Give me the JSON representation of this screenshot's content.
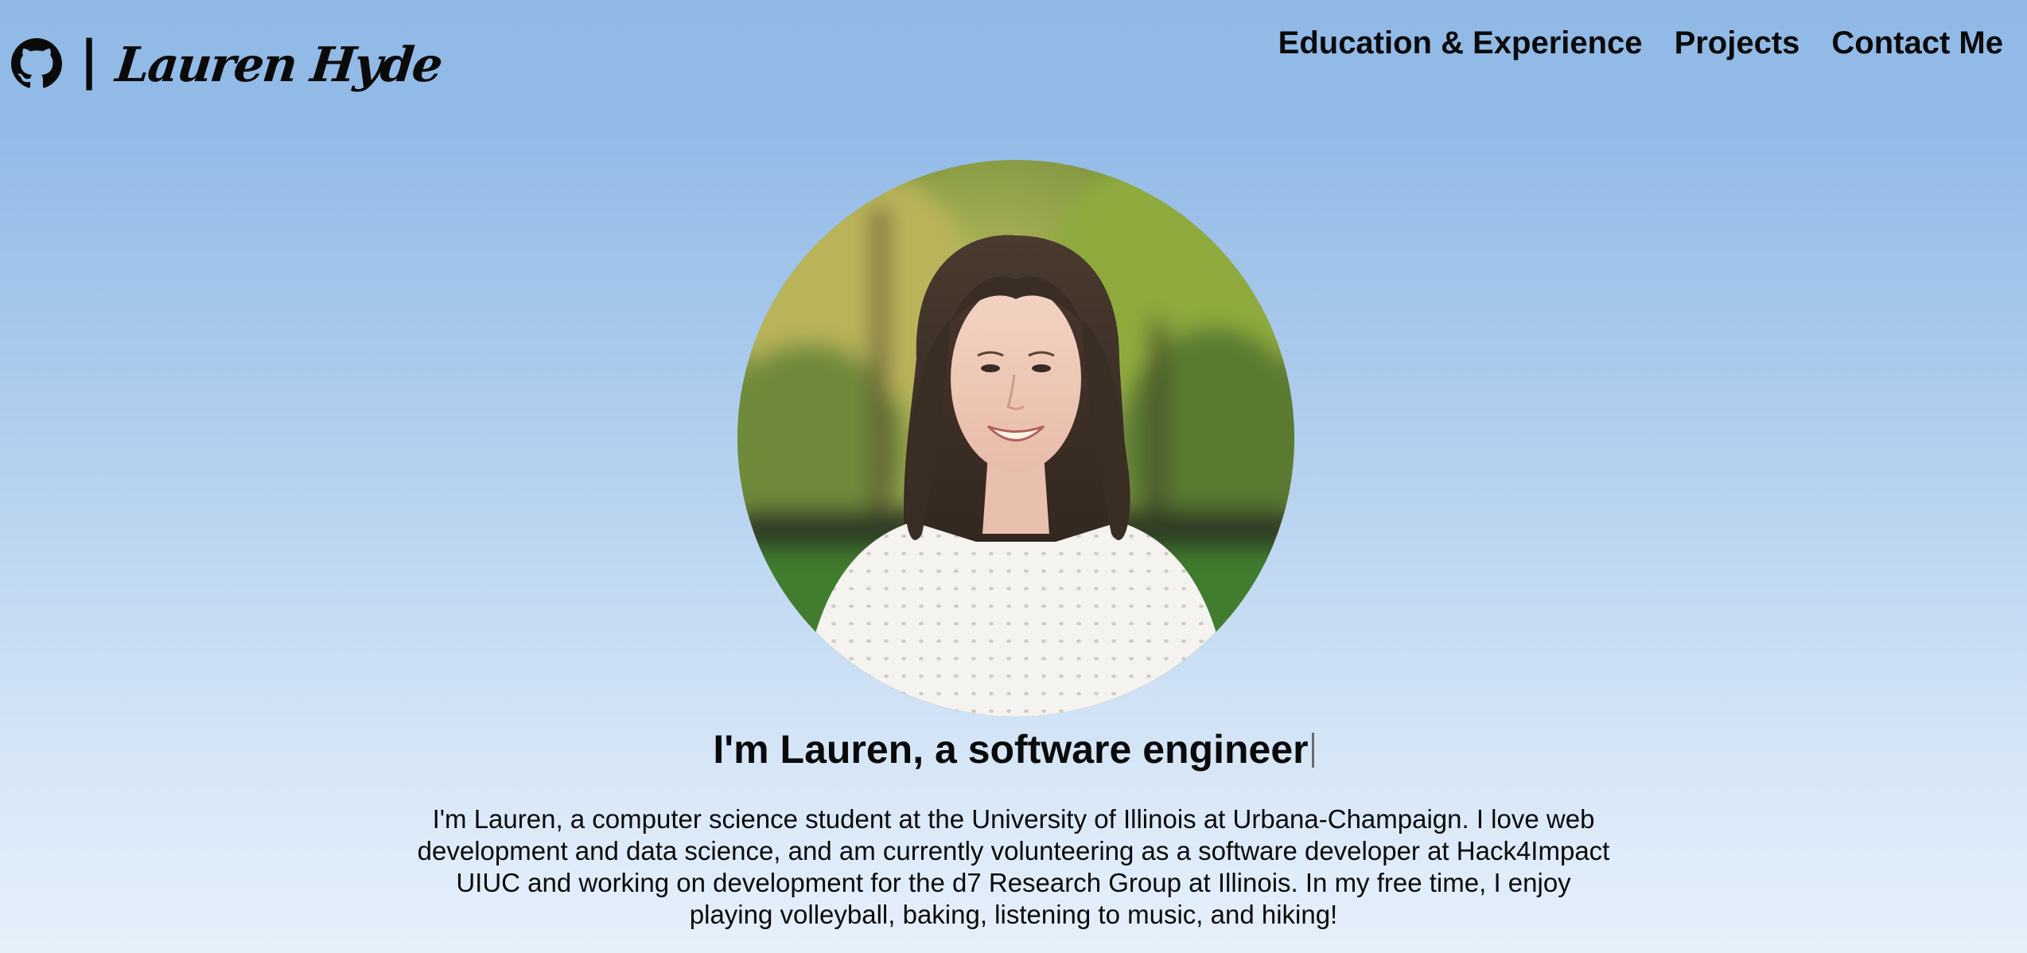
{
  "brand": {
    "icon": "github-icon",
    "separator": "|",
    "name": "Lauren Hyde"
  },
  "nav": {
    "items": [
      {
        "label": "Education & Experience"
      },
      {
        "label": "Projects"
      },
      {
        "label": "Contact Me"
      }
    ]
  },
  "hero": {
    "avatar_icon": "profile-photo",
    "headline": "I'm Lauren, a software engineer",
    "bio": "I'm Lauren, a computer science student at the University of Illinois at Urbana-Champaign. I love web development and data science, and am currently volunteering as a software developer at Hack4Impact UIUC and working on development for the d7 Research Group at Illinois. In my free time, I enjoy playing volleyball, baking, listening to music, and hiking!"
  },
  "colors": {
    "background_top": "#90b9e6",
    "background_bottom": "#e6f0fb",
    "text": "#0a0a0a"
  }
}
